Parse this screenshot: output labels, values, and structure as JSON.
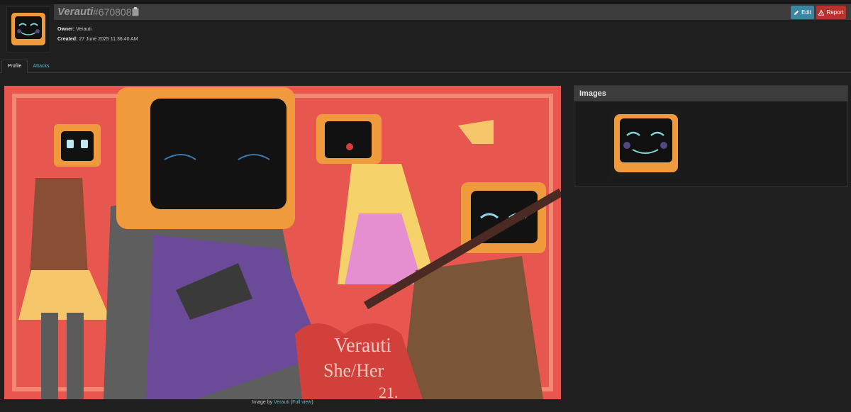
{
  "header": {
    "character_name": "Verauti",
    "character_id": "#6708082",
    "edit_label": "Edit",
    "report_label": "Report"
  },
  "meta": {
    "owner_label": "Owner:",
    "owner_value": "Verauti",
    "created_label": "Created:",
    "created_value": "27 June 2025 11:36:40 AM"
  },
  "tabs": [
    {
      "label": "Profile",
      "active": true
    },
    {
      "label": "Attacks",
      "active": false
    }
  ],
  "main_image": {
    "caption_prefix": "Image by ",
    "caption_author": "Verauti",
    "caption_open": " (",
    "caption_link": "Full view",
    "caption_close": ")",
    "art_text_line1": "Verauti",
    "art_text_line2": "She/Her",
    "art_text_line3": "21."
  },
  "images_panel": {
    "title": "Images"
  },
  "colors": {
    "edit_button": "#3b86a3",
    "report_button": "#b9312d",
    "link": "#5fb8d8",
    "background": "#1f1f1f",
    "art_background": "#e8574f",
    "tv_orange": "#f09a3e"
  },
  "icons": {
    "edit": "pencil-icon",
    "report": "warning-icon",
    "copy": "clipboard-icon"
  }
}
